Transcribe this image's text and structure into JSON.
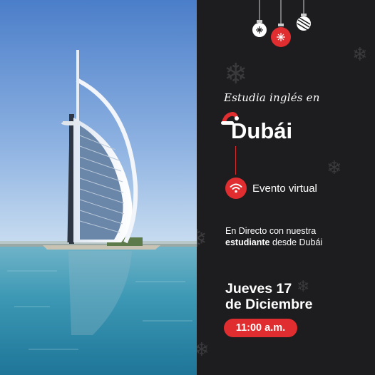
{
  "headline": {
    "eyebrow": "Estudia inglés en",
    "city": "Dubái"
  },
  "event": {
    "icon": "wifi-icon",
    "label": "Evento virtual"
  },
  "description": {
    "line1": "En Directo con nuestra",
    "line2_bold": "estudiante",
    "line2_rest": " desde Dubái"
  },
  "date": {
    "line1": "Jueves 17",
    "line2": "de Diciembre"
  },
  "time": {
    "label": "11:00 a.m."
  },
  "colors": {
    "accent": "#e02d2f",
    "panel": "#1d1d1f",
    "sky": "#5a86c7",
    "sea": "#3a8fae"
  },
  "decor": {
    "ornaments": [
      "snowflake-ornament",
      "red-ornament",
      "striped-ornament"
    ],
    "hat": "santa-hat-icon"
  }
}
